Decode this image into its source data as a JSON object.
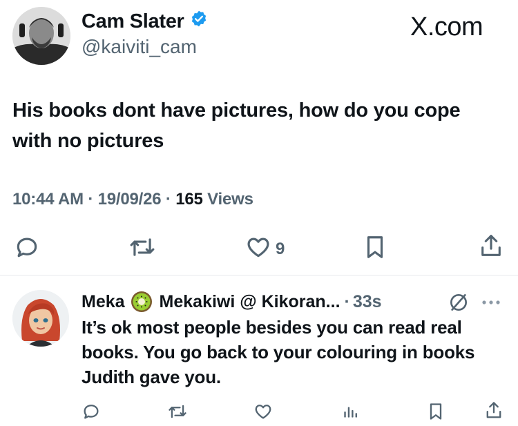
{
  "tweet": {
    "author_name": "Cam Slater",
    "handle": "@kaiviti_cam",
    "brand": "X.com",
    "text": "His books dont have pictures, how do you cope with no pictures",
    "time": "10:44 AM",
    "date": "19/09/26",
    "views_count": "165",
    "views_label": "Views",
    "likes_count": "9",
    "icons": [
      "verified-badge-icon",
      "reply-icon",
      "retweet-icon",
      "like-icon",
      "bookmark-icon",
      "share-icon"
    ],
    "accent_color": "#1d9bf0"
  },
  "reply": {
    "author_name": "Meka",
    "display_suffix": "Mekakiwi @ Kikoran...",
    "separator": "·",
    "time": "33s",
    "text": "It’s ok most people besides you can read real books. You go back to your colouring in books Judith gave you.",
    "icons": [
      "kiwi-emoji-icon",
      "no-entry-icon",
      "more-icon",
      "reply-icon",
      "retweet-icon",
      "like-icon",
      "analytics-icon",
      "bookmark-icon",
      "share-icon"
    ]
  }
}
